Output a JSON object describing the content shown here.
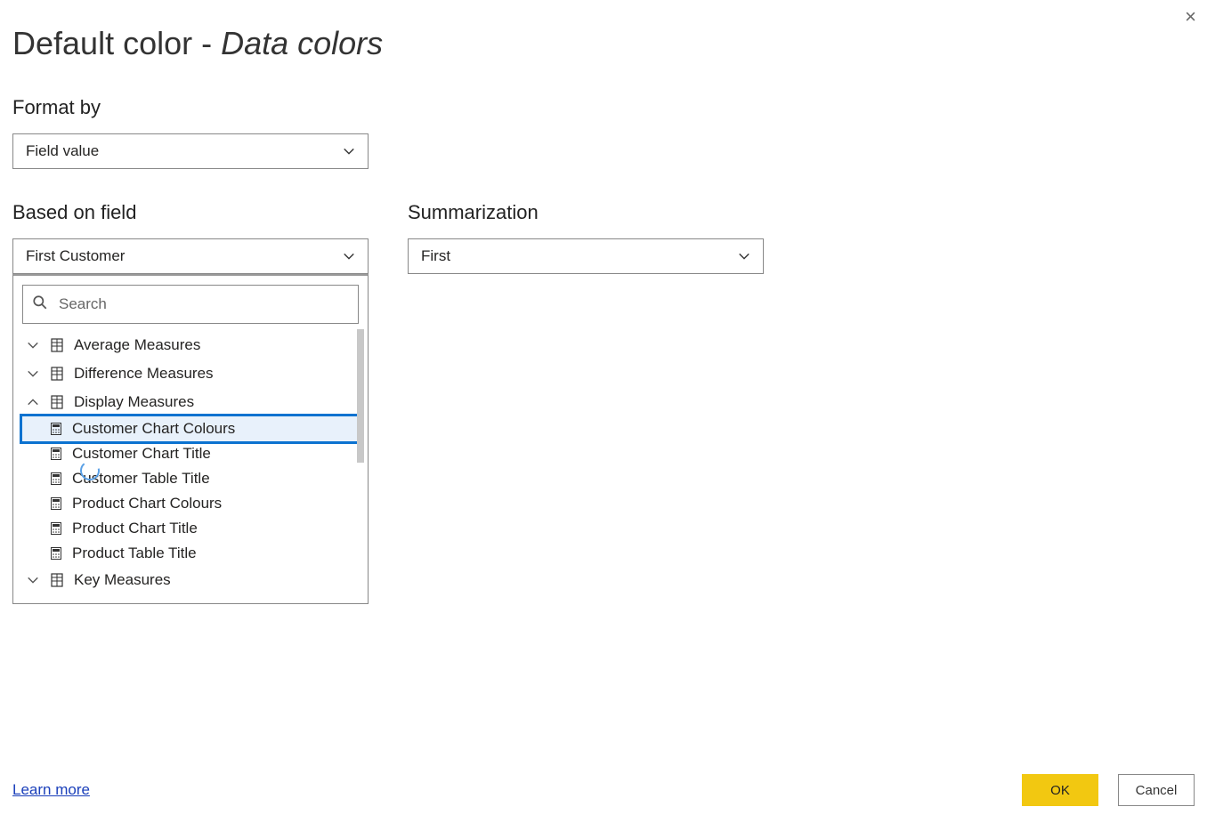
{
  "header": {
    "title_prefix": "Default color - ",
    "title_italic": "Data colors"
  },
  "format_by": {
    "label": "Format by",
    "value": "Field value"
  },
  "based_on_field": {
    "label": "Based on field",
    "value": "First Customer",
    "search_placeholder": "Search",
    "groups": [
      {
        "name": "Average Measures",
        "expanded": false
      },
      {
        "name": "Difference Measures",
        "expanded": false
      },
      {
        "name": "Display Measures",
        "expanded": true
      },
      {
        "name": "Key Measures",
        "expanded": false
      }
    ],
    "display_measures_items": [
      "Customer Chart Colours",
      "Customer Chart Title",
      "Customer Table Title",
      "Product Chart Colours",
      "Product Chart Title",
      "Product Table Title"
    ],
    "highlighted_item": "Customer Chart Colours"
  },
  "summarization": {
    "label": "Summarization",
    "value": "First"
  },
  "footer": {
    "learn_more": "Learn more",
    "ok": "OK",
    "cancel": "Cancel"
  }
}
